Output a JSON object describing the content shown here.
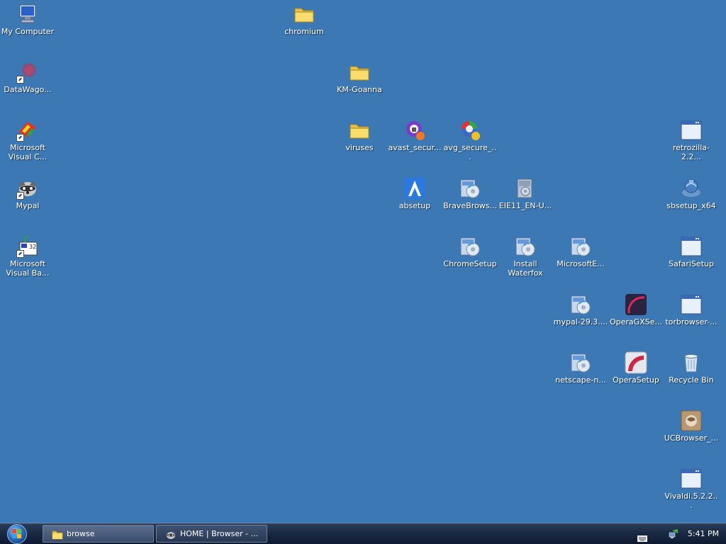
{
  "desktop": {
    "icons": [
      {
        "label": "My Computer",
        "icon": "computer-icon"
      },
      {
        "label": "chromium",
        "icon": "folder-icon"
      },
      {
        "label": "DataWago...",
        "icon": "datawagon-icon"
      },
      {
        "label": "KM-Goanna",
        "icon": "folder-icon"
      },
      {
        "label": "Microsoft\nVisual C...",
        "icon": "visual-c-icon"
      },
      {
        "label": "viruses",
        "icon": "folder-icon"
      },
      {
        "label": "avast_secur...",
        "icon": "avast-icon"
      },
      {
        "label": "avg_secure_...",
        "icon": "avg-icon"
      },
      {
        "label": "retrozilla-2.2...",
        "icon": "window-app-icon"
      },
      {
        "label": "Mypal",
        "icon": "mypal-raccoon-icon"
      },
      {
        "label": "absetup",
        "icon": "absetup-icon"
      },
      {
        "label": "BraveBrows...",
        "icon": "installer-icon"
      },
      {
        "label": "EIE11_EN-U...",
        "icon": "ie-installer-icon"
      },
      {
        "label": "sbsetup_x64",
        "icon": "sbsetup-icon"
      },
      {
        "label": "Microsoft\nVisual Ba...",
        "icon": "visual-basic-icon"
      },
      {
        "label": "ChromeSetup",
        "icon": "installer-icon"
      },
      {
        "label": "Install\nWaterfox",
        "icon": "installer-icon"
      },
      {
        "label": "MicrosoftE...",
        "icon": "installer-icon"
      },
      {
        "label": "SafariSetup",
        "icon": "window-app-icon"
      },
      {
        "label": "mypal-29.3....",
        "icon": "installer-icon"
      },
      {
        "label": "OperaGXSe...",
        "icon": "opera-gx-icon"
      },
      {
        "label": "torbrowser-...",
        "icon": "window-app-icon"
      },
      {
        "label": "netscape-n...",
        "icon": "installer-icon"
      },
      {
        "label": "OperaSetup",
        "icon": "opera-icon"
      },
      {
        "label": "Recycle Bin",
        "icon": "recycle-bin-icon"
      },
      {
        "label": "UCBrowser_...",
        "icon": "ucbrowser-icon"
      },
      {
        "label": "Vivaldi.5.2.2...",
        "icon": "window-app-icon"
      }
    ]
  },
  "taskbar": {
    "start_icon": "windows-orb-icon",
    "tasks": [
      {
        "label": "browse",
        "icon": "folder-icon"
      },
      {
        "label": "HOME | Browser - ...",
        "icon": "mypal-raccoon-icon"
      }
    ],
    "tray": {
      "keyboard_icon": "keyboard-icon",
      "network_icon": "network-icon",
      "clock": "5:41 PM"
    }
  },
  "colors": {
    "desktop_background": "#3c78b4",
    "taskbar": "#1b2a44"
  }
}
